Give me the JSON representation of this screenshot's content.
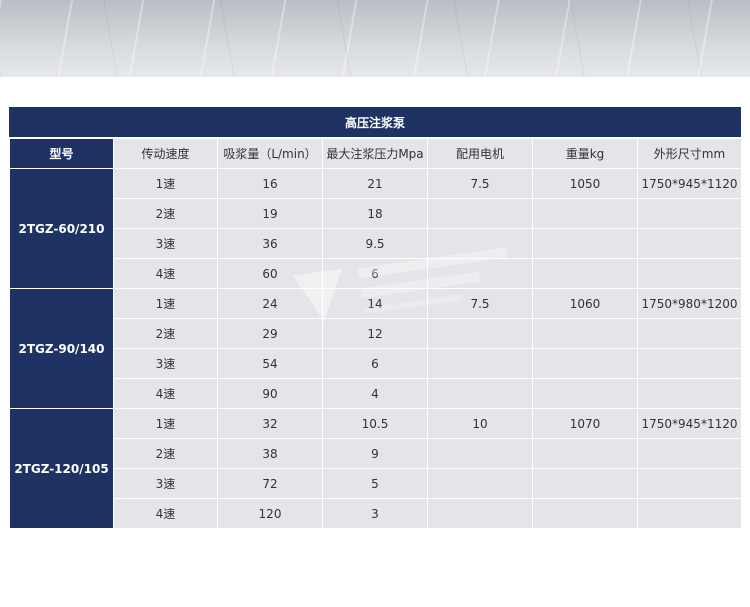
{
  "table": {
    "title": "高压注浆泵",
    "headers": [
      "型号",
      "传动速度",
      "吸浆量（L/min）",
      "最大注浆压力Mpa",
      "配用电机",
      "重量kg",
      "外形尺寸mm"
    ],
    "groups": [
      {
        "model": "2TGZ-60/210",
        "motor": "7.5",
        "weight": "1050",
        "dims": "1750*945*1120",
        "rows": [
          {
            "speed": "1速",
            "flow": "16",
            "pressure": "21"
          },
          {
            "speed": "2速",
            "flow": "19",
            "pressure": "18"
          },
          {
            "speed": "3速",
            "flow": "36",
            "pressure": "9.5"
          },
          {
            "speed": "4速",
            "flow": "60",
            "pressure": "6"
          }
        ]
      },
      {
        "model": "2TGZ-90/140",
        "motor": "7.5",
        "weight": "1060",
        "dims": "1750*980*1200",
        "rows": [
          {
            "speed": "1速",
            "flow": "24",
            "pressure": "14"
          },
          {
            "speed": "2速",
            "flow": "29",
            "pressure": "12"
          },
          {
            "speed": "3速",
            "flow": "54",
            "pressure": "6"
          },
          {
            "speed": "4速",
            "flow": "90",
            "pressure": "4"
          }
        ]
      },
      {
        "model": "2TGZ-120/105",
        "motor": "10",
        "weight": "1070",
        "dims": "1750*945*1120",
        "rows": [
          {
            "speed": "1速",
            "flow": "32",
            "pressure": "10.5"
          },
          {
            "speed": "2速",
            "flow": "38",
            "pressure": "9"
          },
          {
            "speed": "3速",
            "flow": "72",
            "pressure": "5"
          },
          {
            "speed": "4速",
            "flow": "120",
            "pressure": "3"
          }
        ]
      }
    ]
  },
  "colors": {
    "navy": "#1e3364",
    "cell": "#e3e5e8"
  }
}
